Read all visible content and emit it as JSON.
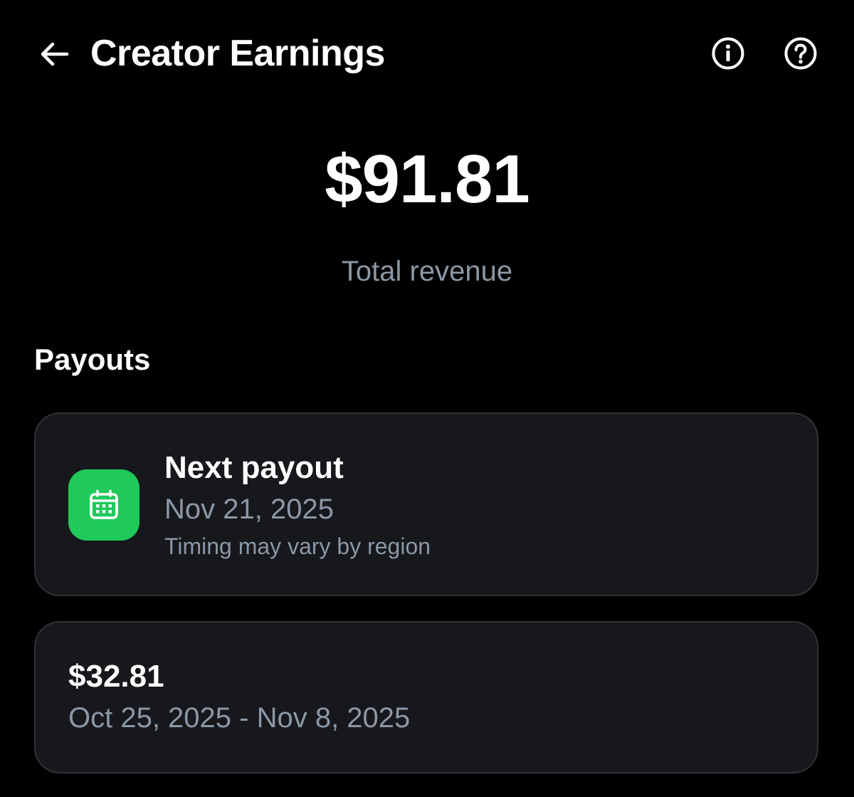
{
  "header": {
    "title": "Creator Earnings",
    "back_icon": "arrow-left-icon",
    "info_icon": "info-circle-icon",
    "help_icon": "question-circle-icon"
  },
  "summary": {
    "amount": "$91.81",
    "label": "Total revenue"
  },
  "payouts": {
    "section_title": "Payouts",
    "next": {
      "title": "Next payout",
      "date": "Nov 21, 2025",
      "note": "Timing may vary by region",
      "icon": "calendar-icon",
      "icon_color": "#1fc95a"
    },
    "history": [
      {
        "amount": "$32.81",
        "range": "Oct 25, 2025 - Nov 8, 2025"
      }
    ]
  },
  "colors": {
    "background": "#000000",
    "card": "#16181c",
    "card_border": "#2f3336",
    "text_primary": "#ffffff",
    "text_secondary": "#8b98a5",
    "accent_green": "#1fc95a"
  }
}
